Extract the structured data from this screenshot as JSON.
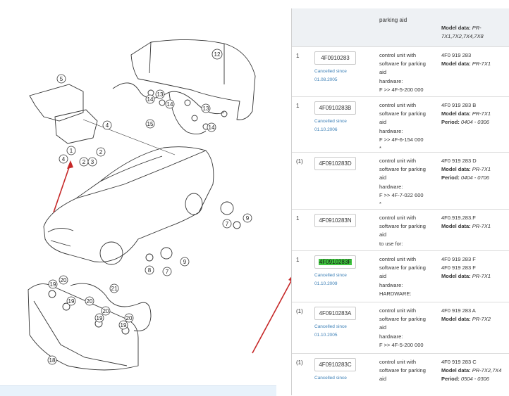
{
  "diagram": {
    "callouts": [
      "1",
      "2",
      "2",
      "3",
      "4",
      "4",
      "5",
      "6",
      "7",
      "7",
      "8",
      "9",
      "9",
      "10",
      "11",
      "12",
      "13",
      "13",
      "13",
      "13",
      "14",
      "14",
      "14",
      "14",
      "15",
      "16",
      "17",
      "18",
      "19",
      "19",
      "19",
      "19",
      "20",
      "20",
      "20",
      "20",
      "21"
    ]
  },
  "table": {
    "header": {
      "description": "parking aid",
      "model_label": "Model data:",
      "model_value": "PR-7X1,7X2,7X4,7X8"
    },
    "model_label": "Model data:",
    "period_label": "Period:",
    "rows": [
      {
        "qty": "1",
        "part": "4F0910283",
        "cancelled": "Cancelled since",
        "date": "01.08.2005",
        "desc": [
          "control unit with",
          "software for parking",
          "aid",
          "hardware:",
          "F >> 4F-5-200 000"
        ],
        "num": "4F0 919 283",
        "model": "PR-7X1",
        "period": ""
      },
      {
        "qty": "1",
        "part": "4F0910283B",
        "cancelled": "Cancelled since",
        "date": "01.10.2006",
        "desc": [
          "control unit with",
          "software for parking",
          "aid",
          "hardware:",
          "F >> 4F-6-154 000",
          "*"
        ],
        "num": "4F0 919 283 B",
        "model": "PR-7X1",
        "period": "0404 - 0306"
      },
      {
        "qty": "(1)",
        "part": "4F0910283D",
        "cancelled": "",
        "date": "",
        "desc": [
          "control unit with",
          "software for parking",
          "aid",
          "hardware:",
          "F >> 4F-7-022 600",
          "*"
        ],
        "num": "4F0 919 283 D",
        "model": "PR-7X1",
        "period": "0404 - 0706"
      },
      {
        "qty": "1",
        "part": "4F0910283N",
        "cancelled": "",
        "date": "",
        "desc": [
          "control unit with",
          "software for parking",
          "aid",
          "to use for:"
        ],
        "num": "4F0.919.283.F",
        "model": "PR-7X1",
        "period": ""
      },
      {
        "qty": "1",
        "part": "4F0910283F",
        "cancelled": "Cancelled since",
        "date": "01.10.2009",
        "desc": [
          "control unit with",
          "software for parking",
          "aid",
          "hardware:",
          "HARDWARE:"
        ],
        "num": "4F0 919 283 F",
        "num2": "4F0 919 283 F",
        "model": "PR-7X1",
        "period": ""
      },
      {
        "qty": "(1)",
        "part": "4F0910283A",
        "cancelled": "Cancelled since",
        "date": "01.10.2005",
        "desc": [
          "control unit with",
          "software for parking",
          "aid",
          "hardware:",
          "F >> 4F-5-200 000"
        ],
        "num": "4F0 919 283 A",
        "model": "PR-7X2",
        "period": ""
      },
      {
        "qty": "(1)",
        "part": "4F0910283C",
        "cancelled": "Cancelled since",
        "date": "",
        "desc": [
          "control unit with",
          "software for parking",
          "aid"
        ],
        "num": "4F0 919 283 C",
        "model": "PR-7X2,7X4",
        "period": "0504 - 0306"
      }
    ]
  },
  "colors": {
    "highlight": "#3fc43f",
    "arrow": "#c62828",
    "link": "#3b7fb6"
  }
}
